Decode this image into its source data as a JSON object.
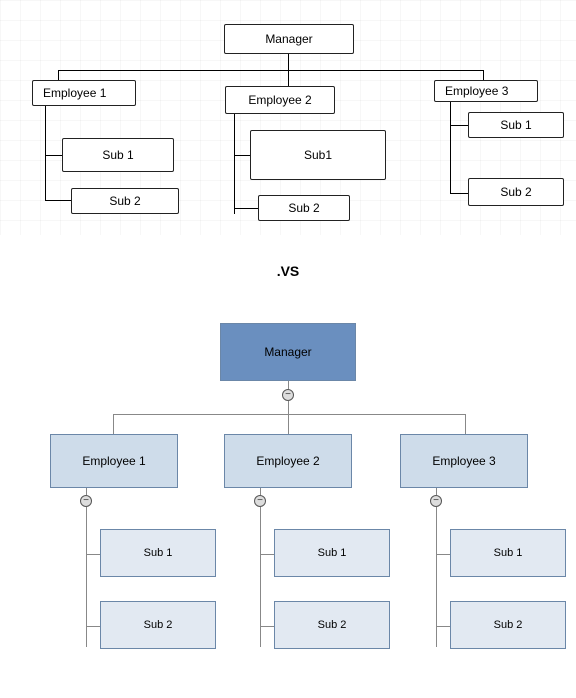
{
  "separator": ".VS",
  "diagram_top": {
    "manager": "Manager",
    "employees": [
      {
        "label": "Employee 1",
        "subs": [
          "Sub 1",
          "Sub 2"
        ]
      },
      {
        "label": "Employee 2",
        "subs": [
          "Sub1",
          "Sub 2"
        ]
      },
      {
        "label": "Employee 3",
        "subs": [
          "Sub 1",
          "Sub 2"
        ]
      }
    ]
  },
  "diagram_bottom": {
    "manager": "Manager",
    "toggle_symbol": "−",
    "employees": [
      {
        "label": "Employee 1",
        "subs": [
          "Sub 1",
          "Sub 2"
        ]
      },
      {
        "label": "Employee 2",
        "subs": [
          "Sub 1",
          "Sub 2"
        ]
      },
      {
        "label": "Employee 3",
        "subs": [
          "Sub 1",
          "Sub 2"
        ]
      }
    ],
    "colors": {
      "manager_fill": "#6a8fbf",
      "employee_fill": "#cedcea",
      "sub_fill": "#e2e9f2",
      "border": "#6b87a8"
    }
  }
}
